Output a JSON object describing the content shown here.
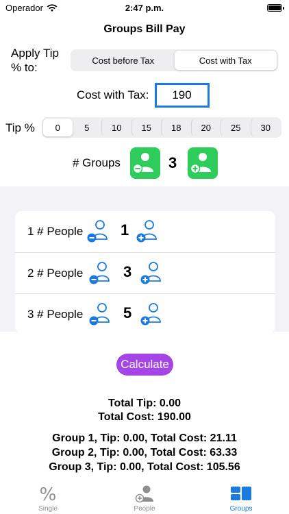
{
  "status_bar": {
    "carrier": "Operador",
    "time": "2:47 p.m."
  },
  "nav": {
    "title": "Groups Bill Pay"
  },
  "apply_tip": {
    "label": "Apply Tip % to:",
    "options": [
      "Cost before Tax",
      "Cost with Tax"
    ],
    "selected": "Cost with Tax"
  },
  "cost": {
    "label": "Cost with Tax:",
    "value": "190"
  },
  "tip": {
    "label": "Tip %",
    "options": [
      "0",
      "5",
      "10",
      "15",
      "18",
      "20",
      "25",
      "30"
    ],
    "selected": "0"
  },
  "groups": {
    "label": "#  Groups",
    "count": "3"
  },
  "people_rows": [
    {
      "label": "1 # People",
      "count": "1"
    },
    {
      "label": "2 # People",
      "count": "3"
    },
    {
      "label": "3 # People",
      "count": "5"
    }
  ],
  "calculate_label": "Calculate",
  "totals": {
    "tip": "Total Tip: 0.00",
    "cost": "Total Cost: 190.00"
  },
  "group_results": [
    "Group 1, Tip: 0.00, Total Cost: 21.11",
    "Group 2, Tip: 0.00, Total Cost: 63.33",
    "Group 3, Tip: 0.00, Total Cost: 105.56"
  ],
  "tabs": [
    {
      "label": "Single",
      "icon": "percent-icon",
      "active": false
    },
    {
      "label": "People",
      "icon": "person-add-icon",
      "active": false
    },
    {
      "label": "Groups",
      "icon": "groups-grid-icon",
      "active": true
    }
  ],
  "colors": {
    "accent_blue": "#1a7ae0",
    "group_button_green": "#2ecc5a",
    "calculate_purple": "#a545e6",
    "section_gray": "#f2f2f7"
  }
}
